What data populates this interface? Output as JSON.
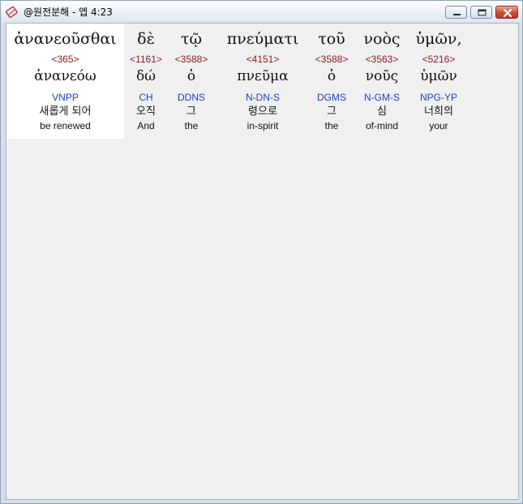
{
  "window": {
    "title": "@원전분해 - 엡 4:23",
    "icon": "scroll-icon",
    "buttons": [
      "minimize-icon",
      "maximize-icon",
      "close-icon"
    ]
  },
  "words": [
    {
      "greek": "ἀνανεοῦσθαι",
      "strong": "<365>",
      "lemma": "ἀνανεόω",
      "parse": "VNPP",
      "korean": "새롭게 되어",
      "english": "be renewed"
    },
    {
      "greek": "δὲ",
      "strong": "<1161>",
      "lemma": "δώ",
      "parse": "CH",
      "korean": "오직",
      "english": "And"
    },
    {
      "greek": "τῷ",
      "strong": "<3588>",
      "lemma": "ὁ",
      "parse": "DDNS",
      "korean": "그",
      "english": "the"
    },
    {
      "greek": "πνεύματι",
      "strong": "<4151>",
      "lemma": "πνεῦμα",
      "parse": "N-DN-S",
      "korean": "령으로",
      "english": "in-spirit"
    },
    {
      "greek": "τοῦ",
      "strong": "<3588>",
      "lemma": "ὁ",
      "parse": "DGMS",
      "korean": "그",
      "english": "the"
    },
    {
      "greek": "νοὸς",
      "strong": "<3563>",
      "lemma": "νοῦς",
      "parse": "N-GM-S",
      "korean": "심",
      "english": "of-mind"
    },
    {
      "greek": "ὑμῶν,",
      "strong": "<5216>",
      "lemma": "ὑμῶν",
      "parse": "NPG-YP",
      "korean": "너희의",
      "english": "your"
    }
  ],
  "colors": {
    "strong_number": "#8b1a1a",
    "parsing_code": "#1f3fbf",
    "background": "#f0f0f0",
    "selected_word_background": "#ffffff"
  }
}
